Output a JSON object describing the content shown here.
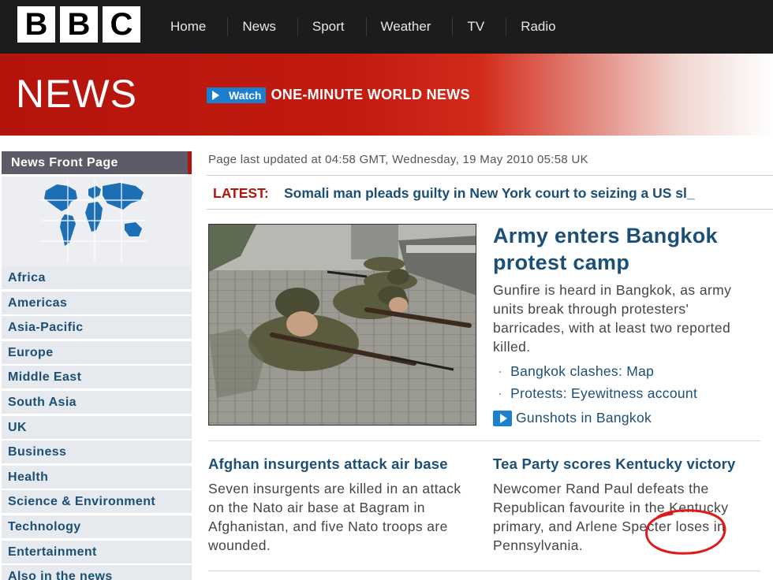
{
  "header": {
    "logo_letters": [
      "B",
      "B",
      "C"
    ],
    "nav": [
      "Home",
      "News",
      "Sport",
      "Weather",
      "TV",
      "Radio"
    ]
  },
  "banner": {
    "title": "NEWS",
    "watch_label": "Watch",
    "watch_title": "ONE-MINUTE WORLD NEWS",
    "watch_icon": "play-icon"
  },
  "sidebar": {
    "heading": "News Front Page",
    "map_icon": "world-map-icon",
    "items": [
      "Africa",
      "Americas",
      "Asia-Pacific",
      "Europe",
      "Middle East",
      "South Asia",
      "UK",
      "Business",
      "Health",
      "Science & Environment",
      "Technology",
      "Entertainment",
      "Also in the news"
    ]
  },
  "main": {
    "updated": "Page last updated at 04:58 GMT, Wednesday, 19 May 2010 05:58 UK",
    "latest_label": "LATEST:",
    "latest_text": "Somali man pleads guilty in New York court to seizing a US sl_",
    "top_story": {
      "headline": "Army enters Bangkok protest camp",
      "summary": "Gunfire is heard in Bangkok, as army units break through protesters' barricades, with at least two reported killed.",
      "related": [
        "Bangkok clashes: Map",
        "Protests: Eyewitness account"
      ],
      "bullet": "·",
      "video_link": "Gunshots in Bangkok",
      "video_icon": "video-icon"
    },
    "stories": [
      {
        "headline": "Afghan insurgents attack air base",
        "summary": "Seven insurgents are killed in an attack on the Nato air base at Bagram in Afghanistan, and five Nato troops are wounded."
      },
      {
        "headline": "Tea Party scores Kentucky victory",
        "summary": "Newcomer Rand Paul defeats the Republican favourite in the Kentucky primary, and Arlene Specter loses in Pennsylvania."
      }
    ]
  },
  "colors": {
    "brand_red": "#b3140c",
    "link_blue": "#1c4f75",
    "annotation_red": "#e0191b"
  }
}
